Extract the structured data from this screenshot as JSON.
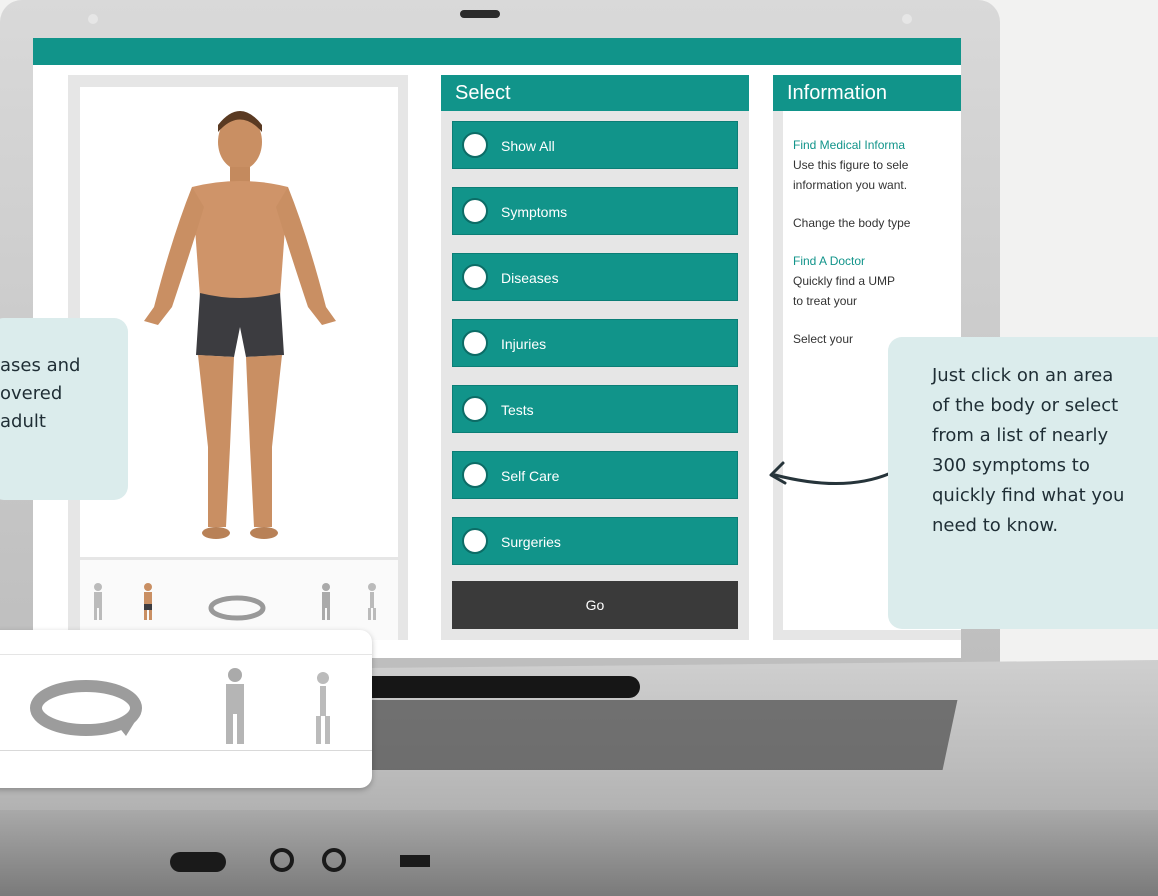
{
  "app": {
    "select_panel": {
      "title": "Select",
      "options": [
        "Show All",
        "Symptoms",
        "Diseases",
        "Injuries",
        "Tests",
        "Self Care",
        "Surgeries"
      ],
      "go_label": "Go"
    },
    "info_panel": {
      "title": "Information",
      "find_med_title": "Find Medical Informa",
      "find_med_line1": "Use this figure to sele",
      "find_med_line2": "information you want.",
      "body_type_line": "Change the body type",
      "find_doctor_title": "Find A Doctor",
      "find_doctor_line1": "Quickly find a UMP",
      "find_doctor_line2": "to treat your",
      "select_your": "Select your"
    }
  },
  "callouts": {
    "left_lines": [
      "ases and",
      "overed",
      "adult"
    ],
    "right_lines": [
      "Just click on an area",
      "of the body or select",
      "from a list of nearly",
      "300 symptoms to",
      "quickly find what you",
      "need to know."
    ]
  },
  "colors": {
    "accent": "#11948a",
    "go_button": "#3a3a3a",
    "callout_bg": "#dbecec"
  },
  "icons": {
    "figure_rotate": "rotate-icon",
    "figure_front": "body-front-icon",
    "figure_back": "body-back-icon"
  }
}
